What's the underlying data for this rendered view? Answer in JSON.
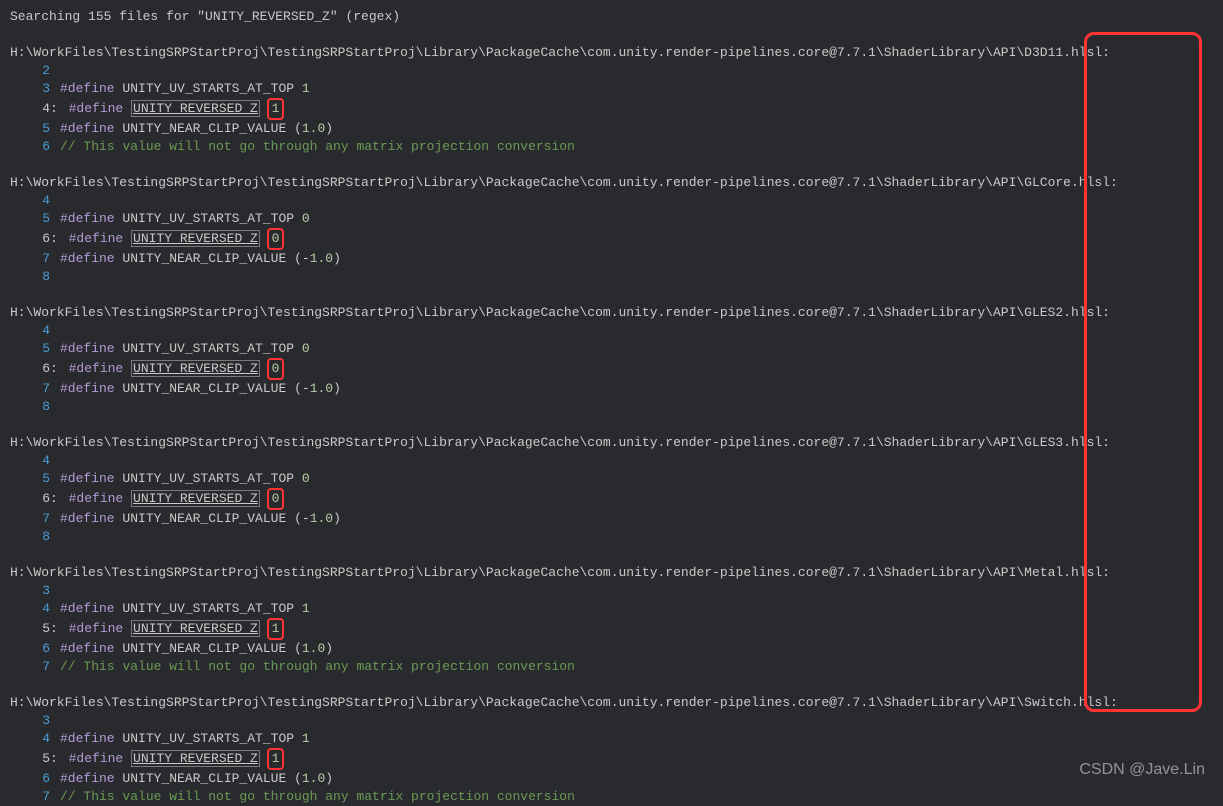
{
  "search": {
    "header": "Searching 155 files for \"UNITY_REVERSED_Z\" (regex)"
  },
  "basePath": "H:\\WorkFiles\\TestingSRPStartProj\\TestingSRPStartProj\\Library\\PackageCache\\com.unity.render-pipelines.core@7.7.1\\ShaderLibrary\\API\\",
  "blocks": [
    {
      "file": "D3D11.hlsl",
      "lines": [
        {
          "num": "2",
          "match": false,
          "text": ""
        },
        {
          "num": "3",
          "match": false,
          "define": "#define",
          "name": "UNITY_UV_STARTS_AT_TOP",
          "val": "1",
          "boxed": false
        },
        {
          "num": "4",
          "match": true,
          "define": "#define",
          "name": "UNITY_REVERSED_Z",
          "val": "1",
          "boxed": true
        },
        {
          "num": "5",
          "match": false,
          "define": "#define",
          "name": "UNITY_NEAR_CLIP_VALUE",
          "val": "(1.0)",
          "boxed": false
        },
        {
          "num": "6",
          "match": false,
          "comment": "// This value will not go through any matrix projection conversion"
        }
      ]
    },
    {
      "file": "GLCore.hlsl",
      "lines": [
        {
          "num": "4",
          "match": false,
          "text": ""
        },
        {
          "num": "5",
          "match": false,
          "define": "#define",
          "name": "UNITY_UV_STARTS_AT_TOP",
          "val": "0",
          "boxed": false
        },
        {
          "num": "6",
          "match": true,
          "define": "#define",
          "name": "UNITY_REVERSED_Z",
          "val": "0",
          "boxed": true
        },
        {
          "num": "7",
          "match": false,
          "define": "#define",
          "name": "UNITY_NEAR_CLIP_VALUE",
          "val": "(-1.0)",
          "boxed": false
        },
        {
          "num": "8",
          "match": false,
          "text": ""
        }
      ]
    },
    {
      "file": "GLES2.hlsl",
      "lines": [
        {
          "num": "4",
          "match": false,
          "text": ""
        },
        {
          "num": "5",
          "match": false,
          "define": "#define",
          "name": "UNITY_UV_STARTS_AT_TOP",
          "val": "0",
          "boxed": false
        },
        {
          "num": "6",
          "match": true,
          "define": "#define",
          "name": "UNITY_REVERSED_Z",
          "val": "0",
          "boxed": true
        },
        {
          "num": "7",
          "match": false,
          "define": "#define",
          "name": "UNITY_NEAR_CLIP_VALUE",
          "val": "(-1.0)",
          "boxed": false
        },
        {
          "num": "8",
          "match": false,
          "text": ""
        }
      ]
    },
    {
      "file": "GLES3.hlsl",
      "lines": [
        {
          "num": "4",
          "match": false,
          "text": ""
        },
        {
          "num": "5",
          "match": false,
          "define": "#define",
          "name": "UNITY_UV_STARTS_AT_TOP",
          "val": "0",
          "boxed": false
        },
        {
          "num": "6",
          "match": true,
          "define": "#define",
          "name": "UNITY_REVERSED_Z",
          "val": "0",
          "boxed": true
        },
        {
          "num": "7",
          "match": false,
          "define": "#define",
          "name": "UNITY_NEAR_CLIP_VALUE",
          "val": "(-1.0)",
          "boxed": false
        },
        {
          "num": "8",
          "match": false,
          "text": ""
        }
      ]
    },
    {
      "file": "Metal.hlsl",
      "lines": [
        {
          "num": "3",
          "match": false,
          "text": ""
        },
        {
          "num": "4",
          "match": false,
          "define": "#define",
          "name": "UNITY_UV_STARTS_AT_TOP",
          "val": "1",
          "boxed": false
        },
        {
          "num": "5",
          "match": true,
          "define": "#define",
          "name": "UNITY_REVERSED_Z",
          "val": "1",
          "boxed": true
        },
        {
          "num": "6",
          "match": false,
          "define": "#define",
          "name": "UNITY_NEAR_CLIP_VALUE",
          "val": "(1.0)",
          "boxed": false
        },
        {
          "num": "7",
          "match": false,
          "comment": "// This value will not go through any matrix projection conversion"
        }
      ]
    },
    {
      "file": "Switch.hlsl",
      "lines": [
        {
          "num": "3",
          "match": false,
          "text": ""
        },
        {
          "num": "4",
          "match": false,
          "define": "#define",
          "name": "UNITY_UV_STARTS_AT_TOP",
          "val": "1",
          "boxed": false
        },
        {
          "num": "5",
          "match": true,
          "define": "#define",
          "name": "UNITY_REVERSED_Z",
          "val": "1",
          "boxed": true
        },
        {
          "num": "6",
          "match": false,
          "define": "#define",
          "name": "UNITY_NEAR_CLIP_VALUE",
          "val": "(1.0)",
          "boxed": false
        },
        {
          "num": "7",
          "match": false,
          "comment": "// This value will not go through any matrix projection conversion"
        }
      ]
    }
  ],
  "watermark": "CSDN @Jave.Lin"
}
